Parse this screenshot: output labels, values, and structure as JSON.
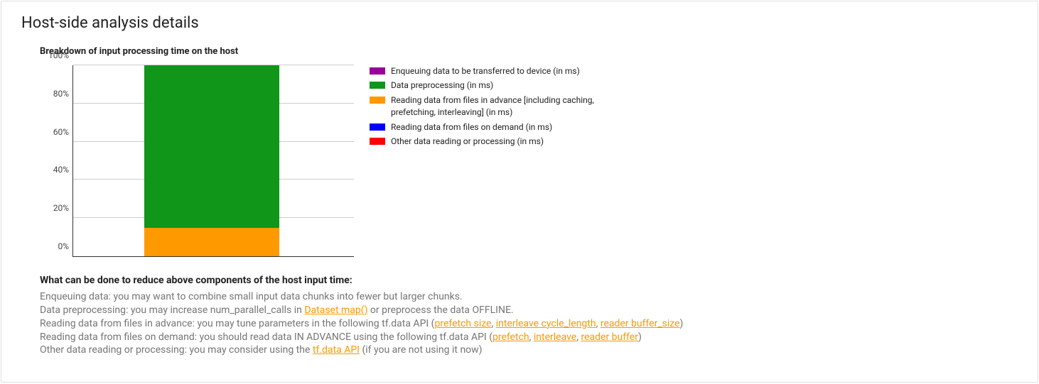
{
  "title": "Host-side analysis details",
  "chart_title": "Breakdown of input processing time on the host",
  "chart_data": {
    "type": "bar",
    "categories": [
      ""
    ],
    "series": [
      {
        "name": "Enqueuing data to be transferred to device (in ms)",
        "key": "enq",
        "color": "#990099",
        "values": [
          0
        ]
      },
      {
        "name": "Data preprocessing (in ms)",
        "key": "prep",
        "color": "#109618",
        "values": [
          85
        ]
      },
      {
        "name": "Reading data from files in advance [including caching, prefetching, interleaving] (in ms)",
        "key": "adv",
        "color": "#ff9900",
        "values": [
          15
        ]
      },
      {
        "name": "Reading data from files on demand (in ms)",
        "key": "ond",
        "color": "#0000ff",
        "values": [
          0
        ]
      },
      {
        "name": "Other data reading or processing (in ms)",
        "key": "other",
        "color": "#ff0000",
        "values": [
          0
        ]
      }
    ],
    "title": "Breakdown of input processing time on the host",
    "xlabel": "",
    "ylabel": "",
    "ylim": [
      0,
      100
    ],
    "yticks": [
      "0%",
      "20%",
      "40%",
      "60%",
      "80%",
      "100%"
    ]
  },
  "advice": {
    "heading": "What can be done to reduce above components of the host input time:",
    "lines": {
      "enq": "Enqueuing data: you may want to combine small input data chunks into fewer but larger chunks.",
      "prep1": "Data preprocessing: you may increase num_parallel_calls in ",
      "prep_link": "Dataset map()",
      "prep2": " or preprocess the data OFFLINE.",
      "adv1": "Reading data from files in advance: you may tune parameters in the following tf.data API (",
      "adv_l1": "prefetch size",
      "adv_c1": ", ",
      "adv_l2": "interleave cycle_length",
      "adv_c2": ", ",
      "adv_l3": "reader buffer_size",
      "adv2": ")",
      "ond1": "Reading data from files on demand: you should read data IN ADVANCE using the following tf.data API (",
      "ond_l1": "prefetch",
      "ond_c1": ", ",
      "ond_l2": "interleave",
      "ond_c2": ", ",
      "ond_l3": "reader buffer",
      "ond2": ")",
      "oth1": "Other data reading or processing: you may consider using the ",
      "oth_l": "tf.data API",
      "oth2": " (if you are not using it now)"
    }
  }
}
